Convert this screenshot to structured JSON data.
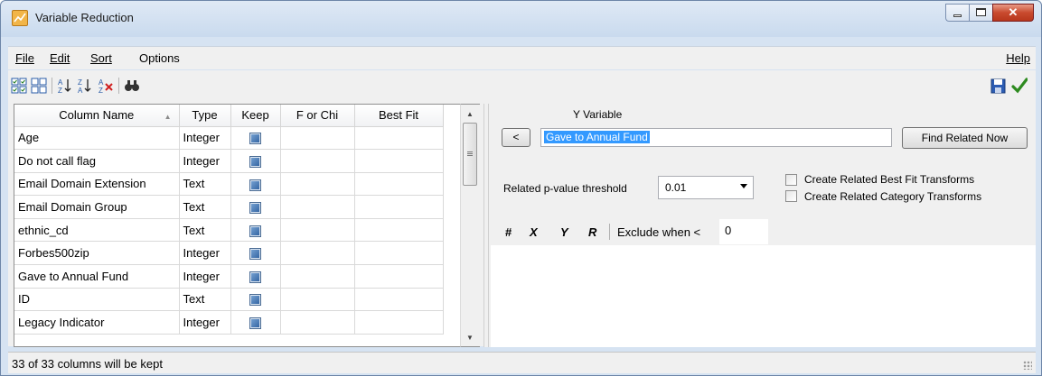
{
  "window": {
    "title": "Variable Reduction"
  },
  "menu": {
    "file": "File",
    "edit": "Edit",
    "sort": "Sort",
    "options": "Options",
    "help": "Help"
  },
  "toolbar": {
    "icons": [
      "select-all-icon",
      "deselect-all-icon",
      "sort-ascending-icon",
      "sort-descending-icon",
      "clear-sort-icon",
      "find-icon",
      "save-icon",
      "apply-checkmark-icon"
    ]
  },
  "grid": {
    "headers": [
      "Column Name",
      "Type",
      "Keep",
      "F or Chi",
      "Best Fit"
    ],
    "rows": [
      {
        "name": "Age",
        "type": "Integer",
        "keep": true,
        "f": "",
        "fit": ""
      },
      {
        "name": "Do not call flag",
        "type": "Integer",
        "keep": true,
        "f": "",
        "fit": ""
      },
      {
        "name": "Email Domain Extension",
        "type": "Text",
        "keep": true,
        "f": "",
        "fit": ""
      },
      {
        "name": "Email Domain Group",
        "type": "Text",
        "keep": true,
        "f": "",
        "fit": ""
      },
      {
        "name": "ethnic_cd",
        "type": "Text",
        "keep": true,
        "f": "",
        "fit": ""
      },
      {
        "name": "Forbes500zip",
        "type": "Integer",
        "keep": true,
        "f": "",
        "fit": ""
      },
      {
        "name": "Gave to Annual Fund",
        "type": "Integer",
        "keep": true,
        "f": "",
        "fit": ""
      },
      {
        "name": "ID",
        "type": "Text",
        "keep": true,
        "f": "",
        "fit": ""
      },
      {
        "name": "Legacy Indicator",
        "type": "Integer",
        "keep": true,
        "f": "",
        "fit": ""
      }
    ]
  },
  "right": {
    "y_label": "Y Variable",
    "back_button": "<",
    "y_value": "Gave to Annual Fund",
    "find_button": "Find Related Now",
    "pvalue_label": "Related p-value threshold",
    "pvalue_selected": "0.01",
    "cb1": "Create Related Best Fit Transforms",
    "cb2": "Create Related Category Transforms",
    "hash": "#",
    "x": "X",
    "y": "Y",
    "r": "R",
    "exclude_label": "Exclude when <",
    "exclude_value": "0"
  },
  "status": {
    "text": "33 of 33 columns will be kept"
  }
}
